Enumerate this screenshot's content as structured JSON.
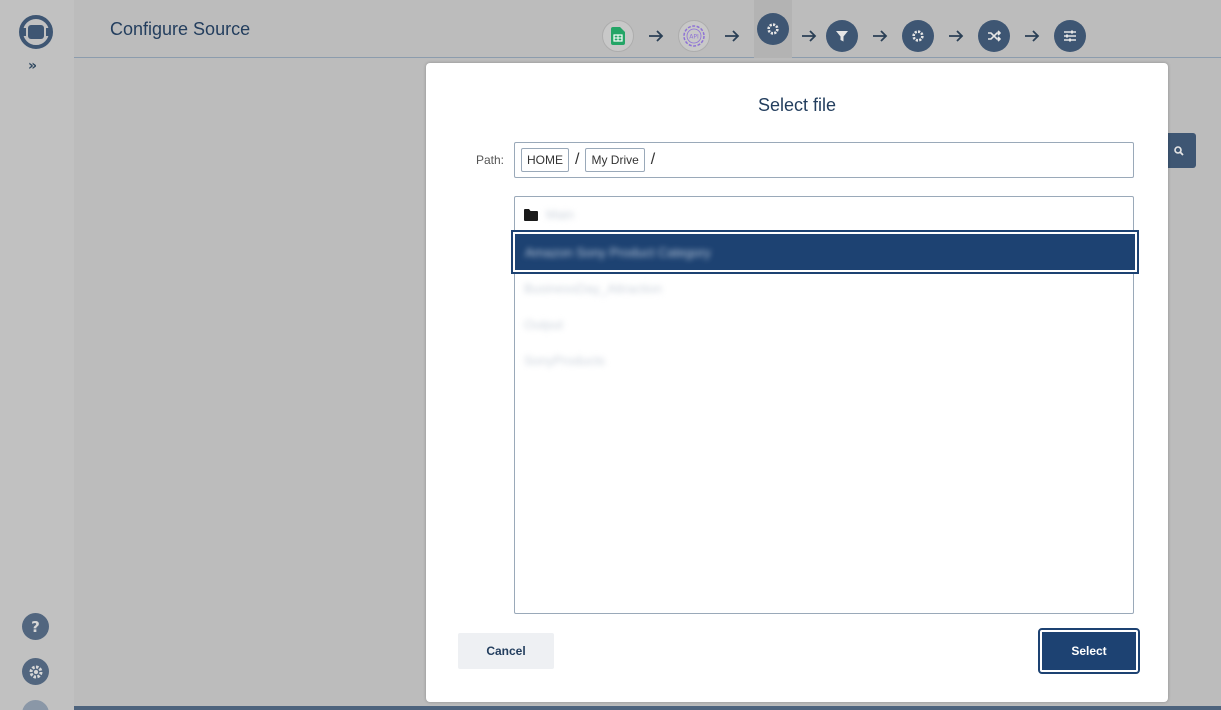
{
  "header": {
    "title": "Configure Source",
    "steps": [
      {
        "name": "google-sheets-icon"
      },
      {
        "name": "api-gear-icon"
      },
      {
        "name": "gear-icon"
      },
      {
        "name": "filter-icon"
      },
      {
        "name": "gear-icon"
      },
      {
        "name": "shuffle-icon"
      },
      {
        "name": "sliders-icon"
      }
    ]
  },
  "rail": {
    "expand_label": "»",
    "help_label": "?"
  },
  "modal": {
    "title": "Select file",
    "path_label": "Path:",
    "breadcrumb": [
      "HOME",
      "My Drive"
    ],
    "separator": "/",
    "files": [
      {
        "label": "Main",
        "type": "folder"
      },
      {
        "label": "Amazon Sony Product Category",
        "type": "file",
        "selected": true
      },
      {
        "label": "BusinessDay_Attraction",
        "type": "file"
      },
      {
        "label": "Output",
        "type": "file"
      },
      {
        "label": "SonyProducts",
        "type": "file"
      }
    ],
    "cancel_label": "Cancel",
    "select_label": "Select"
  },
  "colors": {
    "primary": "#1d4272",
    "icon_dark": "#3e5673",
    "overlay": "#bcbcbc"
  }
}
